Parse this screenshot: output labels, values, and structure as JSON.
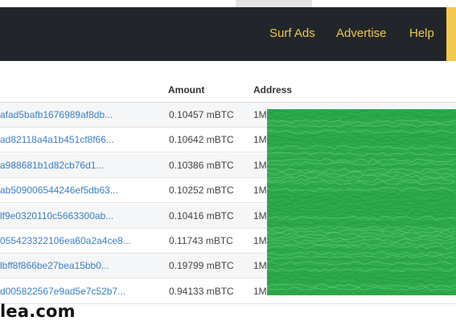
{
  "nav": {
    "items": [
      {
        "label": "Surf Ads"
      },
      {
        "label": "Advertise"
      },
      {
        "label": "Help"
      }
    ]
  },
  "table": {
    "headers": {
      "amount": "Amount",
      "address": "Address"
    },
    "rows": [
      {
        "tx": "afad5bafb1676989af8db...",
        "amount": "0.10457 mBTC",
        "address": "1M"
      },
      {
        "tx": "ad82118a4a1b451cf8f66...",
        "amount": "0.10642 mBTC",
        "address": "1M"
      },
      {
        "tx": "a988681b1d82cb76d1...",
        "amount": "0.10386 mBTC",
        "address": "1M"
      },
      {
        "tx": "ab509006544246ef5db63...",
        "amount": "0.10252 mBTC",
        "address": "1M"
      },
      {
        "tx": "lf9e0320110c5663300ab...",
        "amount": "0.10416 mBTC",
        "address": "1M"
      },
      {
        "tx": "055423322106ea60a2a4ce8...",
        "amount": "0.11743 mBTC",
        "address": "1M"
      },
      {
        "tx": "lbff8f866be27bea15bb0...",
        "amount": "0.19799 mBTC",
        "address": "1M"
      },
      {
        "tx": "d005822567e9ad5e7c52b7...",
        "amount": "0.94133 mBTC",
        "address": "1M"
      }
    ]
  },
  "footer": {
    "brand": "lea.com"
  },
  "colors": {
    "nav_bg": "#22262a",
    "nav_link": "#f2c84b",
    "accent": "#f6c94b",
    "link": "#3c7fc3",
    "redaction": "#2eaa4a"
  }
}
